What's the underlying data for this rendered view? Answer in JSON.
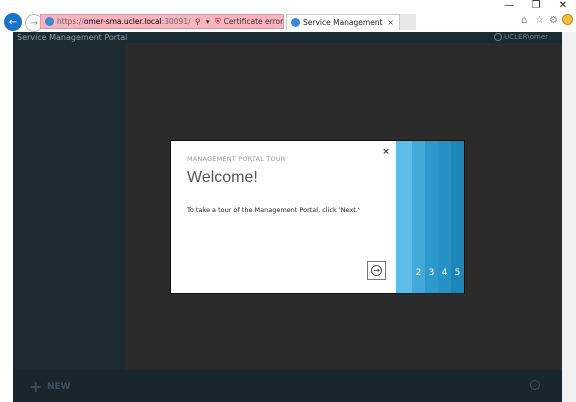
{
  "browser": {
    "window_controls": {
      "minimize": "—",
      "restore": "❐",
      "close": "✕"
    },
    "address_bar": {
      "url_scheme": "https://",
      "url_host": "omer-sma.ucler.local",
      "url_rest": ":30091/",
      "search_icon": "search-icon",
      "dropdown_icon": "chevron-down-icon",
      "cert_error_label": "Certificate error",
      "refresh_icon": "refresh-icon"
    },
    "tab": {
      "label": "Service Management",
      "close": "×"
    },
    "right_icons": [
      "home-icon",
      "star-icon",
      "gear-icon",
      "smiley-icon"
    ]
  },
  "portal": {
    "title": "Service Management Portal",
    "user_label": "UCLER\\omer",
    "footer": {
      "new_label": "NEW",
      "new_icon": "plus-icon",
      "help_icon": "help-icon"
    }
  },
  "dialog": {
    "kicker": "MANAGEMENT PORTAL TOUR",
    "title": "Welcome!",
    "body": "To take a tour of the Management Portal, click 'Next.'",
    "close_glyph": "×",
    "next_glyph": "→",
    "steps": [
      {
        "label": "",
        "color": "#5bbde8"
      },
      {
        "label": "2",
        "color": "#41a8d8"
      },
      {
        "label": "3",
        "color": "#2c9acc"
      },
      {
        "label": "4",
        "color": "#2591c4"
      },
      {
        "label": "5",
        "color": "#1d85b8"
      }
    ]
  }
}
